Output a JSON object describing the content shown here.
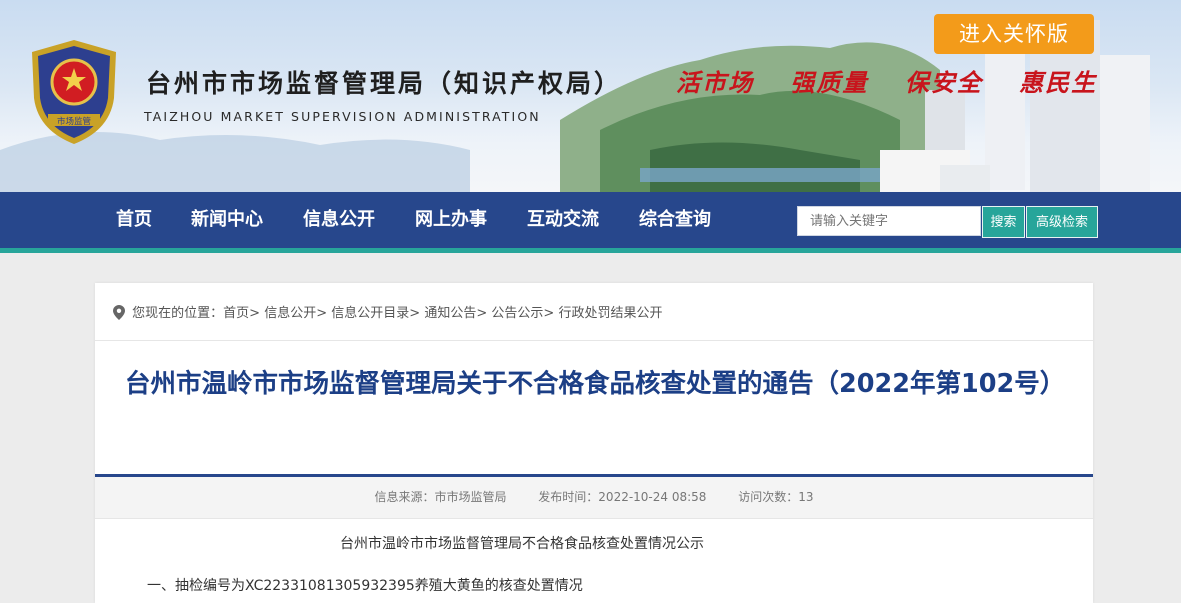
{
  "header": {
    "site_title": "台州市市场监督管理局（知识产权局）",
    "site_subtitle": "TAIZHOU MARKET SUPERVISION ADMINISTRATION",
    "emblem_text": "市场监管",
    "slogans": [
      "活市场",
      "强质量",
      "保安全",
      "惠民生"
    ],
    "care_button": "进入关怀版"
  },
  "nav": {
    "items": [
      "首页",
      "新闻中心",
      "信息公开",
      "网上办事",
      "互动交流",
      "综合查询"
    ]
  },
  "search": {
    "placeholder": "请输入关键字",
    "search_label": "搜索",
    "advanced_label": "高级检索"
  },
  "breadcrumb": {
    "prefix": "您现在的位置：",
    "items": [
      "首页",
      "信息公开",
      "信息公开目录",
      "通知公告",
      "公告公示",
      "行政处罚结果公开"
    ],
    "separator": ">"
  },
  "article": {
    "title": "台州市温岭市市场监督管理局关于不合格食品核查处置的通告（2022年第102号）",
    "source": "信息来源：市市场监管局",
    "publish_time": "发布时间：2022-10-24 08:58",
    "visits": "访问次数：13",
    "body_heading": "台州市温岭市市场监督管理局不合格食品核查处置情况公示",
    "body_item1": "一、抽检编号为XC22331081305932395养殖大黄鱼的核查处置情况"
  },
  "colors": {
    "nav_bg": "#27478c",
    "accent_teal": "#27a59a",
    "care_button": "#f39b1a",
    "title_blue": "#1c3f86",
    "slogan_red": "#c8141c"
  }
}
